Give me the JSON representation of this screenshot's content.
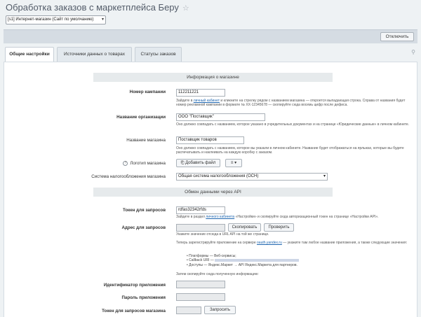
{
  "page": {
    "title": "Обработка заказов с маркетплейса Беру",
    "star_icon": "☆"
  },
  "site_select": {
    "value": "[s1] Интернет-магазин (Сайт по умолчанию)"
  },
  "toolbar": {
    "disable_label": "Отключить",
    "pin_icon": "pin-icon"
  },
  "tabs": [
    {
      "label": "Общие настройки",
      "active": true
    },
    {
      "label": "Источники данных о товарах",
      "active": false
    },
    {
      "label": "Статусы заказов",
      "active": false
    }
  ],
  "shop_section": {
    "header": "Информация о магазине",
    "campaign": {
      "label": "Номер кампании",
      "value": "112211221",
      "hint_pre": "Зайдите в ",
      "hint_link": "личный кабинет",
      "hint_post": " и кликните на стрелку рядом с названием магазина — откроется выпадающая строка. Справа от названия будет номер рекламной кампании в формате № XX-12345678 — скопируйте сюда восемь цифр после дефиса."
    },
    "org": {
      "label": "Название организации",
      "value": "ООО \"Поставщик\"",
      "hint": "Оно должно совпадать с названием, которое указано в учредительных документах и на странице «Юридические данные» в личном кабинете."
    },
    "shop_name": {
      "label": "Название магазина",
      "value": "Поставщик товаров",
      "hint": "Оно должно совпадать с названием, которое вы указали в личном кабинете. Название будет отображаться на ярлыках, которые вы будете распечатывать и наклеивать на каждую коробку с заказом."
    },
    "logo": {
      "label": "Логотип магазина",
      "add_file_label": "Добавить файл",
      "help_icon": "?"
    },
    "tax": {
      "label": "Система налогообложения магазина",
      "value": "Общая система налогообложения (ОСН)"
    }
  },
  "api_section": {
    "header": "Обмен данными через API",
    "token": {
      "label": "Токен для запросов",
      "value": "rdfas32342rfds",
      "hint_pre": "Зайдите в раздел ",
      "hint_link": "личного кабинета",
      "hint_post": " «Настройки» и скопируйте сюда авторизационный токен на странице «Настройки API»."
    },
    "address": {
      "label": "Адрес для запросов",
      "copy_label": "Скопировать",
      "check_label": "Проверить",
      "hint": "Укажите значение отсюда в URL API на той же странице."
    },
    "register": {
      "text_pre": "Теперь зарегистрируйте приложение на сервере ",
      "text_link": "oauth.yandex.ru",
      "text_post": " — укажите там любое название приложения, а также следующие значения:",
      "bullets": [
        "Платформы — Веб-сервисы;",
        "Callback URI —",
        "Доступы — Яндекс.Маркет → API Яндекс.Маркета для партнеров."
      ],
      "copy_hint": "Затем скопируйте сюда полученную информацию:"
    },
    "app_id": {
      "label": "Идентификатор приложения"
    },
    "app_password": {
      "label": "Пароль приложения"
    },
    "shop_token": {
      "label": "Токен для запросов магазина",
      "request_label": "Запросить"
    }
  }
}
